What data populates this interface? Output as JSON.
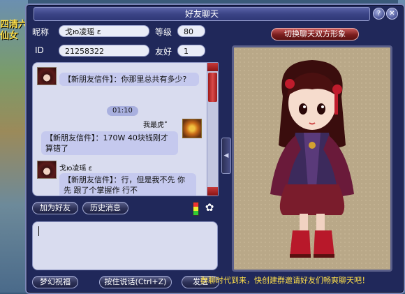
{
  "window": {
    "title": "好友聊天"
  },
  "info": {
    "nickname_label": "昵称",
    "nickname_value": "戈ю凌瑶 ε",
    "level_label": "等级",
    "level_value": "80",
    "id_label": "ID",
    "id_value": "21258322",
    "friendship_label": "友好",
    "friendship_value": "1"
  },
  "buttons": {
    "switch_image": "切换聊天双方形象",
    "add_friend": "加为好友",
    "history": "历史消息",
    "dream_bless": "梦幻祝福",
    "voice": "按住说话(Ctrl+Z)",
    "send": "发送"
  },
  "chat": {
    "messages": [
      {
        "text": "【新朋友信件】：你那里总共有多少?"
      },
      {
        "time": "01:10"
      },
      {
        "sender": "我最虎˚",
        "text": "【新朋友信件】：170W 40块钱刚才算错了"
      },
      {
        "sender": "戈ю凌瑶 ε",
        "text": "【新朋友信件】：行，但是我不先 你先 跟了个掌握作 行不"
      }
    ]
  },
  "input": {
    "value": ""
  },
  "background": {
    "left_text_1": "四清六",
    "left_text_2": "仙女"
  },
  "ticker": {
    "text": "群聊时代到来，快创建群邀请好友们畅爽聊天吧！"
  },
  "icons": [
    "help-icon",
    "close-icon",
    "signal-icon",
    "gift-icon",
    "scroll-up-icon",
    "scroll-down-icon"
  ]
}
